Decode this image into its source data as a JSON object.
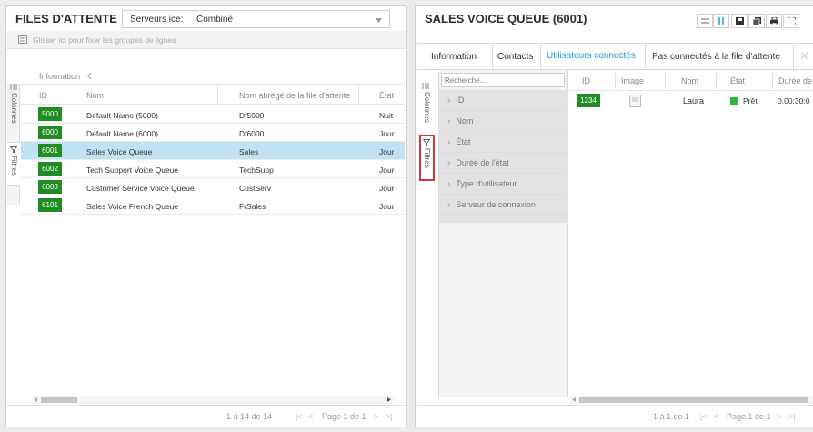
{
  "left_panel": {
    "title": "FILES D'ATTENTE",
    "server_label": "Serveurs ice:",
    "server_value": "Combiné",
    "group_hint": "Glisser ici pour fixer les groupes de lignes",
    "group_header": "Information",
    "side_columns": "Colonnes",
    "side_filters": "Filtres",
    "columns": [
      "ID",
      "Nom",
      "Nom abrégé de la file d'attente",
      "État"
    ],
    "rows": [
      {
        "id": "5000",
        "name": "Default Name (5000)",
        "short": "Df5000",
        "state": "Nuit",
        "selected": false
      },
      {
        "id": "6000",
        "name": "Default Name (6000)",
        "short": "Df6000",
        "state": "Jour",
        "selected": false
      },
      {
        "id": "6001",
        "name": "Sales Voice Queue",
        "short": "Sales",
        "state": "Jour",
        "selected": true
      },
      {
        "id": "6002",
        "name": "Tech Support Voice Queue",
        "short": "TechSupp",
        "state": "Jour",
        "selected": false
      },
      {
        "id": "6003",
        "name": "Customer Service Voice Queue",
        "short": "CustServ",
        "state": "Jour",
        "selected": false
      },
      {
        "id": "6101",
        "name": "Sales Voice French Queue",
        "short": "FrSales",
        "state": "Jour",
        "selected": false
      }
    ],
    "row_count": "1 à 14 de 14",
    "page_label": "Page 1 de 1"
  },
  "right_panel": {
    "title": "SALES VOICE QUEUE (6001)",
    "tabs": [
      "Information",
      "Contacts",
      "Utilisateurs connectés",
      "Pas connectés à la file d'attente"
    ],
    "active_tab_index": 2,
    "search_placeholder": "Recherche...",
    "side_columns": "Colonnes",
    "side_filters": "Filtres",
    "filters": [
      "ID",
      "Nom",
      "État",
      "Durée de l'état",
      "Type d'utilisateur",
      "Serveur de connexion"
    ],
    "columns": [
      "ID",
      "Image",
      "Nom",
      "État",
      "Durée de"
    ],
    "rows": [
      {
        "id": "1234",
        "name": "Laura",
        "state": "Prêt",
        "duration": "0.00:30:0"
      }
    ],
    "row_count": "1 à 1 de 1",
    "page_label": "Page 1 de 1"
  },
  "colors": {
    "accent_green": "#1f8d24",
    "selection_blue": "#bfe2f5",
    "active_tab_blue": "#1a9ad6",
    "highlight_red": "#d93434"
  }
}
